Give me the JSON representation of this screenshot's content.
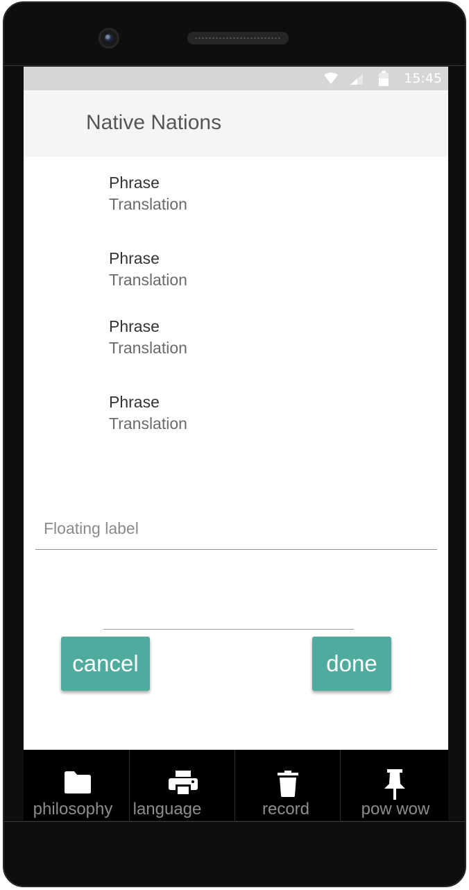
{
  "status_bar": {
    "time": "15:45",
    "icons": [
      "wifi-icon",
      "signal-icon",
      "battery-icon"
    ]
  },
  "app_bar": {
    "title": "Native Nations"
  },
  "phrase_list": [
    {
      "phrase": "Phrase",
      "translation": "Translation"
    },
    {
      "phrase": "Phrase",
      "translation": "Translation"
    },
    {
      "phrase": "Phrase",
      "translation": "Translation"
    },
    {
      "phrase": "Phrase",
      "translation": "Translation"
    }
  ],
  "input": {
    "floating_label": "Floating label",
    "value": ""
  },
  "actions": {
    "cancel_label": "cancel",
    "done_label": "done",
    "button_color": "#4fab9e"
  },
  "bottom_nav": {
    "items": [
      {
        "label": "philosophy",
        "icon": "folder-icon"
      },
      {
        "label": "language",
        "icon": "printer-icon"
      },
      {
        "label": "record",
        "icon": "trash-icon"
      },
      {
        "label": "pow wow",
        "icon": "pin-icon"
      }
    ]
  }
}
